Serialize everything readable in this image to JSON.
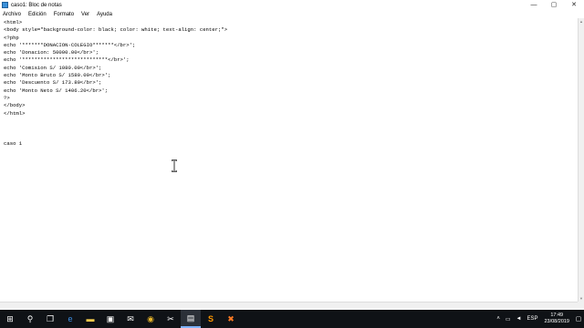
{
  "window": {
    "title": "caso1: Bloc de notas",
    "controls": [
      "—",
      "▢",
      "✕"
    ]
  },
  "menu": [
    "Archivo",
    "Edición",
    "Formato",
    "Ver",
    "Ayuda"
  ],
  "editor": {
    "lines": [
      "<html>",
      "<body style=\"background-color: black; color: white; text-align: center;\">",
      "<?php",
      "echo '*******DONACION-COLEGIO*******</br>';",
      "echo 'Donacion: 50000.00</br>';",
      "echo '****************************</br>';",
      "echo 'Comision S/ 1080.00</br>';",
      "echo 'Monto Bruto S/ 1580.00</br>';",
      "echo 'Descuento S/ 173.80</br>';",
      "echo 'Monto Neto S/ 1406.20</br>';",
      "?>",
      "</body>",
      "</html>",
      "",
      "",
      "",
      "caso 1"
    ]
  },
  "taskbar": {
    "apps": [
      {
        "name": "start",
        "glyph": "⊞"
      },
      {
        "name": "search",
        "glyph": "⚲"
      },
      {
        "name": "task-view",
        "glyph": "❐"
      },
      {
        "name": "edge",
        "glyph": "e"
      },
      {
        "name": "file-explorer",
        "glyph": "▬"
      },
      {
        "name": "store",
        "glyph": "▣"
      },
      {
        "name": "mail",
        "glyph": "✉"
      },
      {
        "name": "chrome",
        "glyph": "◉"
      },
      {
        "name": "snipping",
        "glyph": "✂"
      },
      {
        "name": "notepad",
        "glyph": "▤"
      },
      {
        "name": "sublime",
        "glyph": "S"
      },
      {
        "name": "xampp",
        "glyph": "✖"
      }
    ],
    "language": "ESP",
    "time": "17:49",
    "date": "23/08/2019"
  }
}
